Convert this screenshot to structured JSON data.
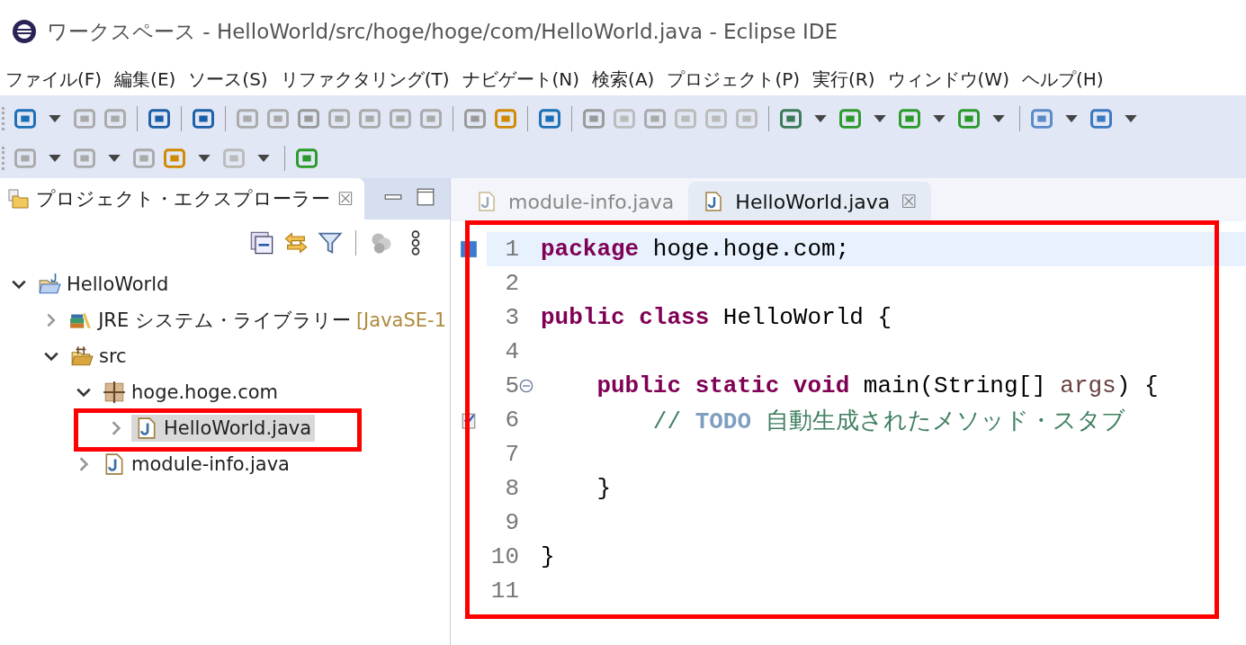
{
  "window": {
    "title": "ワークスペース - HelloWorld/src/hoge/hoge/com/HelloWorld.java - Eclipse IDE"
  },
  "menu": [
    "ファイル(F)",
    "編集(E)",
    "ソース(S)",
    "リファクタリング(T)",
    "ナビゲート(N)",
    "検索(A)",
    "プロジェクト(P)",
    "実行(R)",
    "ウィンドウ(W)",
    "ヘルプ(H)"
  ],
  "explorer": {
    "tab": {
      "label": "プロジェクト・エクスプローラー",
      "close": "☒"
    },
    "tree": [
      {
        "label": "HelloWorld",
        "kind": "project",
        "expanded": true,
        "selected": false,
        "children": [
          {
            "label": "JRE システム・ライブラリー",
            "decoration": "[JavaSE-1",
            "kind": "library",
            "expanded": false,
            "selected": false
          },
          {
            "label": "src",
            "kind": "source",
            "expanded": true,
            "selected": false,
            "children": [
              {
                "label": "hoge.hoge.com",
                "kind": "package",
                "expanded": true,
                "selected": false,
                "children": [
                  {
                    "label": "HelloWorld.java",
                    "kind": "file",
                    "expanded": false,
                    "selected": true
                  }
                ]
              },
              {
                "label": "module-info.java",
                "kind": "file",
                "expanded": false,
                "selected": false
              }
            ]
          }
        ]
      }
    ]
  },
  "editor": {
    "tabs": [
      {
        "label": "module-info.java",
        "selected": false
      },
      {
        "label": "HelloWorld.java",
        "selected": true,
        "close": "☒"
      }
    ],
    "lines": [
      {
        "number": "1",
        "current": true,
        "kind": "occurrence",
        "tokens": [
          {
            "kind": "keyword",
            "text": "package"
          },
          {
            "kind": "plain",
            "text": " hoge.hoge.com;"
          }
        ]
      },
      {
        "number": "2",
        "current": false,
        "kind": "plain"
      },
      {
        "number": "3",
        "current": false,
        "kind": "plain",
        "tokens": [
          {
            "kind": "keyword",
            "text": "public"
          },
          {
            "kind": "keyword",
            "text": " class"
          },
          {
            "kind": "plain",
            "text": " HelloWorld {"
          }
        ]
      },
      {
        "number": "4",
        "current": false,
        "kind": "plain"
      },
      {
        "number": "5",
        "current": false,
        "kind": "fold",
        "tokens": [
          {
            "kind": "keyword",
            "text": "    public"
          },
          {
            "kind": "keyword",
            "text": " static"
          },
          {
            "kind": "keyword",
            "text": " void"
          },
          {
            "kind": "plain",
            "text": " main(String[] "
          },
          {
            "kind": "param",
            "text": "args"
          },
          {
            "kind": "plain",
            "text": ") {"
          }
        ]
      },
      {
        "number": "6",
        "current": false,
        "kind": "task",
        "tokens": [
          {
            "kind": "comment",
            "text": "        // "
          },
          {
            "kind": "todo",
            "text": "TODO"
          },
          {
            "kind": "comment",
            "text": " 自動生成されたメソッド・スタブ"
          }
        ]
      },
      {
        "number": "7",
        "current": false,
        "kind": "plain"
      },
      {
        "number": "8",
        "current": false,
        "kind": "plain",
        "tokens": [
          {
            "kind": "plain",
            "text": "    }"
          }
        ]
      },
      {
        "number": "9",
        "current": false,
        "kind": "plain"
      },
      {
        "number": "10",
        "current": false,
        "kind": "plain",
        "tokens": [
          {
            "kind": "plain",
            "text": "}"
          }
        ]
      },
      {
        "number": "11",
        "current": false,
        "kind": "plain"
      }
    ]
  }
}
